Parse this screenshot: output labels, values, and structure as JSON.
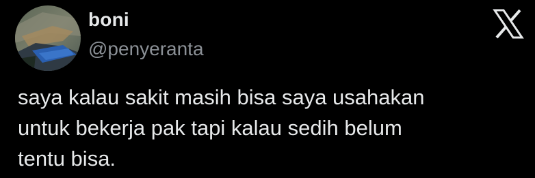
{
  "tweet": {
    "display_name": "boni",
    "handle": "@penyeranta",
    "text": "saya kalau sakit masih bisa saya usahakan\nuntuk bekerja pak tapi kalau sedih belum\ntentu bisa."
  },
  "icons": {
    "platform_logo": "x-logo-icon",
    "avatar": "profile-avatar"
  },
  "colors": {
    "background": "#000000",
    "text_primary": "#e7e9ea",
    "text_secondary": "#8b9096"
  }
}
